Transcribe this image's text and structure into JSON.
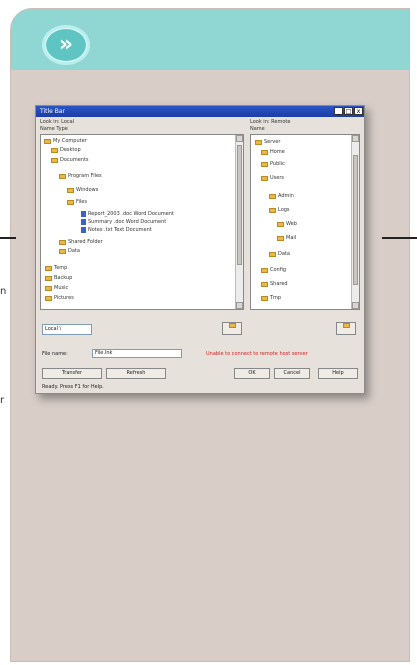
{
  "header": {
    "badge_glyph": "»",
    "accent_color": "#90d6d3",
    "badge_color": "#5fc5c3"
  },
  "page": {
    "background": "#d8cdc7",
    "edge_left_1": "n",
    "edge_left_2": "r"
  },
  "dialog": {
    "title": "Title Bar",
    "min": "_",
    "max": "□",
    "close": "x",
    "left_pane": {
      "toolbar_1": "Look in: Local",
      "toolbar_2": "Name  Type",
      "rows": [
        "My Computer",
        "Desktop",
        "Documents",
        "Program Files",
        "Windows",
        "Files",
        "Report_2003 .doc  Word Document",
        "Summary .doc   Word Document",
        "Notes .txt   Text Document",
        "Shared Folder",
        "Data",
        "Temp",
        "Backup",
        "Music",
        "Pictures"
      ]
    },
    "right_pane": {
      "toolbar_1": "Look in: Remote",
      "toolbar_2": "Name",
      "rows": [
        "Server",
        "Home",
        "Public",
        "Users",
        "Admin",
        "Logs",
        "Web",
        "Mail",
        "Data",
        "Config",
        "Shared",
        "Tmp"
      ]
    },
    "left_path": "Local \\",
    "right_path": "",
    "filename_label": "File name:",
    "filename_value": "File.lnk",
    "error_text": "Unable to connect to remote host server",
    "left_btn_1": "Transfer",
    "left_btn_2": "Refresh",
    "right_btn_1": "OK",
    "right_btn_2": "Cancel",
    "right_btn_3": "Help",
    "status_text": "Ready. Press F1 for Help."
  }
}
